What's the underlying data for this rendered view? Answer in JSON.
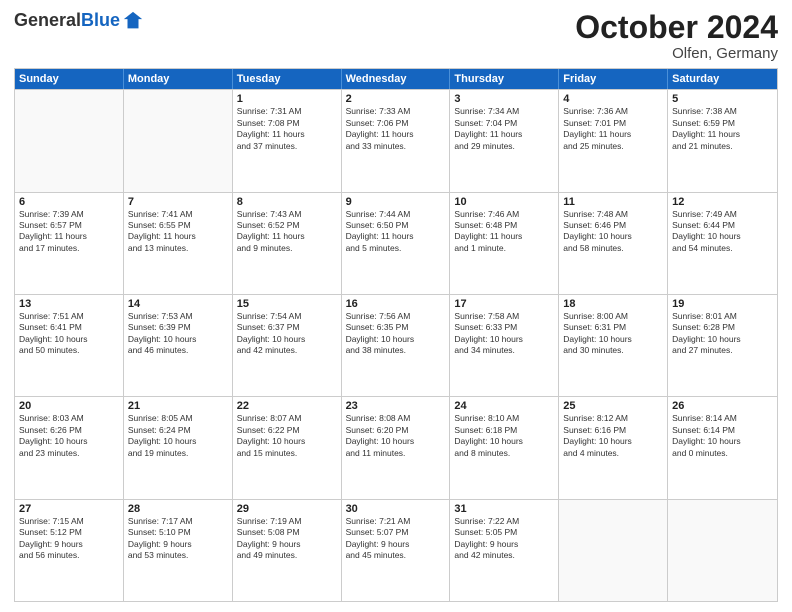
{
  "logo": {
    "general": "General",
    "blue": "Blue"
  },
  "header": {
    "month": "October 2024",
    "location": "Olfen, Germany"
  },
  "weekdays": [
    "Sunday",
    "Monday",
    "Tuesday",
    "Wednesday",
    "Thursday",
    "Friday",
    "Saturday"
  ],
  "rows": [
    [
      {
        "day": "",
        "empty": true
      },
      {
        "day": "",
        "empty": true
      },
      {
        "day": "1",
        "lines": [
          "Sunrise: 7:31 AM",
          "Sunset: 7:08 PM",
          "Daylight: 11 hours",
          "and 37 minutes."
        ]
      },
      {
        "day": "2",
        "lines": [
          "Sunrise: 7:33 AM",
          "Sunset: 7:06 PM",
          "Daylight: 11 hours",
          "and 33 minutes."
        ]
      },
      {
        "day": "3",
        "lines": [
          "Sunrise: 7:34 AM",
          "Sunset: 7:04 PM",
          "Daylight: 11 hours",
          "and 29 minutes."
        ]
      },
      {
        "day": "4",
        "lines": [
          "Sunrise: 7:36 AM",
          "Sunset: 7:01 PM",
          "Daylight: 11 hours",
          "and 25 minutes."
        ]
      },
      {
        "day": "5",
        "lines": [
          "Sunrise: 7:38 AM",
          "Sunset: 6:59 PM",
          "Daylight: 11 hours",
          "and 21 minutes."
        ]
      }
    ],
    [
      {
        "day": "6",
        "lines": [
          "Sunrise: 7:39 AM",
          "Sunset: 6:57 PM",
          "Daylight: 11 hours",
          "and 17 minutes."
        ]
      },
      {
        "day": "7",
        "lines": [
          "Sunrise: 7:41 AM",
          "Sunset: 6:55 PM",
          "Daylight: 11 hours",
          "and 13 minutes."
        ]
      },
      {
        "day": "8",
        "lines": [
          "Sunrise: 7:43 AM",
          "Sunset: 6:52 PM",
          "Daylight: 11 hours",
          "and 9 minutes."
        ]
      },
      {
        "day": "9",
        "lines": [
          "Sunrise: 7:44 AM",
          "Sunset: 6:50 PM",
          "Daylight: 11 hours",
          "and 5 minutes."
        ]
      },
      {
        "day": "10",
        "lines": [
          "Sunrise: 7:46 AM",
          "Sunset: 6:48 PM",
          "Daylight: 11 hours",
          "and 1 minute."
        ]
      },
      {
        "day": "11",
        "lines": [
          "Sunrise: 7:48 AM",
          "Sunset: 6:46 PM",
          "Daylight: 10 hours",
          "and 58 minutes."
        ]
      },
      {
        "day": "12",
        "lines": [
          "Sunrise: 7:49 AM",
          "Sunset: 6:44 PM",
          "Daylight: 10 hours",
          "and 54 minutes."
        ]
      }
    ],
    [
      {
        "day": "13",
        "lines": [
          "Sunrise: 7:51 AM",
          "Sunset: 6:41 PM",
          "Daylight: 10 hours",
          "and 50 minutes."
        ]
      },
      {
        "day": "14",
        "lines": [
          "Sunrise: 7:53 AM",
          "Sunset: 6:39 PM",
          "Daylight: 10 hours",
          "and 46 minutes."
        ]
      },
      {
        "day": "15",
        "lines": [
          "Sunrise: 7:54 AM",
          "Sunset: 6:37 PM",
          "Daylight: 10 hours",
          "and 42 minutes."
        ]
      },
      {
        "day": "16",
        "lines": [
          "Sunrise: 7:56 AM",
          "Sunset: 6:35 PM",
          "Daylight: 10 hours",
          "and 38 minutes."
        ]
      },
      {
        "day": "17",
        "lines": [
          "Sunrise: 7:58 AM",
          "Sunset: 6:33 PM",
          "Daylight: 10 hours",
          "and 34 minutes."
        ]
      },
      {
        "day": "18",
        "lines": [
          "Sunrise: 8:00 AM",
          "Sunset: 6:31 PM",
          "Daylight: 10 hours",
          "and 30 minutes."
        ]
      },
      {
        "day": "19",
        "lines": [
          "Sunrise: 8:01 AM",
          "Sunset: 6:28 PM",
          "Daylight: 10 hours",
          "and 27 minutes."
        ]
      }
    ],
    [
      {
        "day": "20",
        "lines": [
          "Sunrise: 8:03 AM",
          "Sunset: 6:26 PM",
          "Daylight: 10 hours",
          "and 23 minutes."
        ]
      },
      {
        "day": "21",
        "lines": [
          "Sunrise: 8:05 AM",
          "Sunset: 6:24 PM",
          "Daylight: 10 hours",
          "and 19 minutes."
        ]
      },
      {
        "day": "22",
        "lines": [
          "Sunrise: 8:07 AM",
          "Sunset: 6:22 PM",
          "Daylight: 10 hours",
          "and 15 minutes."
        ]
      },
      {
        "day": "23",
        "lines": [
          "Sunrise: 8:08 AM",
          "Sunset: 6:20 PM",
          "Daylight: 10 hours",
          "and 11 minutes."
        ]
      },
      {
        "day": "24",
        "lines": [
          "Sunrise: 8:10 AM",
          "Sunset: 6:18 PM",
          "Daylight: 10 hours",
          "and 8 minutes."
        ]
      },
      {
        "day": "25",
        "lines": [
          "Sunrise: 8:12 AM",
          "Sunset: 6:16 PM",
          "Daylight: 10 hours",
          "and 4 minutes."
        ]
      },
      {
        "day": "26",
        "lines": [
          "Sunrise: 8:14 AM",
          "Sunset: 6:14 PM",
          "Daylight: 10 hours",
          "and 0 minutes."
        ]
      }
    ],
    [
      {
        "day": "27",
        "lines": [
          "Sunrise: 7:15 AM",
          "Sunset: 5:12 PM",
          "Daylight: 9 hours",
          "and 56 minutes."
        ]
      },
      {
        "day": "28",
        "lines": [
          "Sunrise: 7:17 AM",
          "Sunset: 5:10 PM",
          "Daylight: 9 hours",
          "and 53 minutes."
        ]
      },
      {
        "day": "29",
        "lines": [
          "Sunrise: 7:19 AM",
          "Sunset: 5:08 PM",
          "Daylight: 9 hours",
          "and 49 minutes."
        ]
      },
      {
        "day": "30",
        "lines": [
          "Sunrise: 7:21 AM",
          "Sunset: 5:07 PM",
          "Daylight: 9 hours",
          "and 45 minutes."
        ]
      },
      {
        "day": "31",
        "lines": [
          "Sunrise: 7:22 AM",
          "Sunset: 5:05 PM",
          "Daylight: 9 hours",
          "and 42 minutes."
        ]
      },
      {
        "day": "",
        "empty": true
      },
      {
        "day": "",
        "empty": true
      }
    ]
  ]
}
